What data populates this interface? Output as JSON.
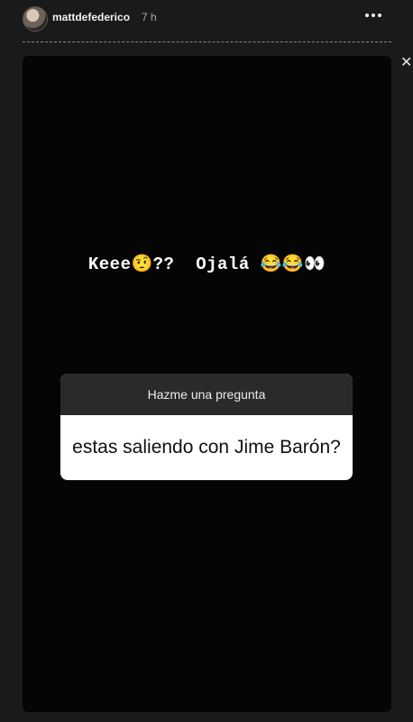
{
  "header": {
    "username": "mattdefederico",
    "time_ago": "7 h"
  },
  "story": {
    "caption": "Keee🤨??  Ojalá 😂😂👀",
    "question_sticker": {
      "title": "Hazme una pregunta",
      "question": "estas saliendo con Jime Barón?"
    }
  },
  "icons": {
    "more": "more-options-icon",
    "close": "close-icon"
  },
  "colors": {
    "background": "#1a1a1a",
    "story_background": "#050505",
    "sticker_header": "#2a2a2a",
    "sticker_body": "#ffffff"
  }
}
